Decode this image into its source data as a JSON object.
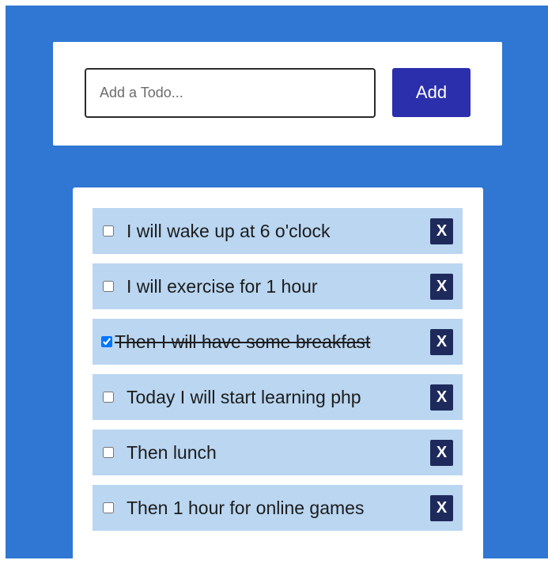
{
  "add_form": {
    "input_value": "",
    "input_placeholder": "Add a Todo...",
    "add_label": "Add"
  },
  "todos": [
    {
      "text": "I will wake up at 6 o'clock",
      "done": false,
      "delete_label": "X"
    },
    {
      "text": "I will exercise for 1 hour",
      "done": false,
      "delete_label": "X"
    },
    {
      "text": "Then I will have some breakfast",
      "done": true,
      "delete_label": "X"
    },
    {
      "text": "Today I will start learning php",
      "done": false,
      "delete_label": "X"
    },
    {
      "text": "Then lunch",
      "done": false,
      "delete_label": "X"
    },
    {
      "text": "Then 1 hour for online games",
      "done": false,
      "delete_label": "X"
    }
  ],
  "colors": {
    "page_background": "#2f77d3",
    "add_button": "#2b2fac",
    "item_background": "#bad6f1",
    "delete_button": "#1f2a5c"
  }
}
